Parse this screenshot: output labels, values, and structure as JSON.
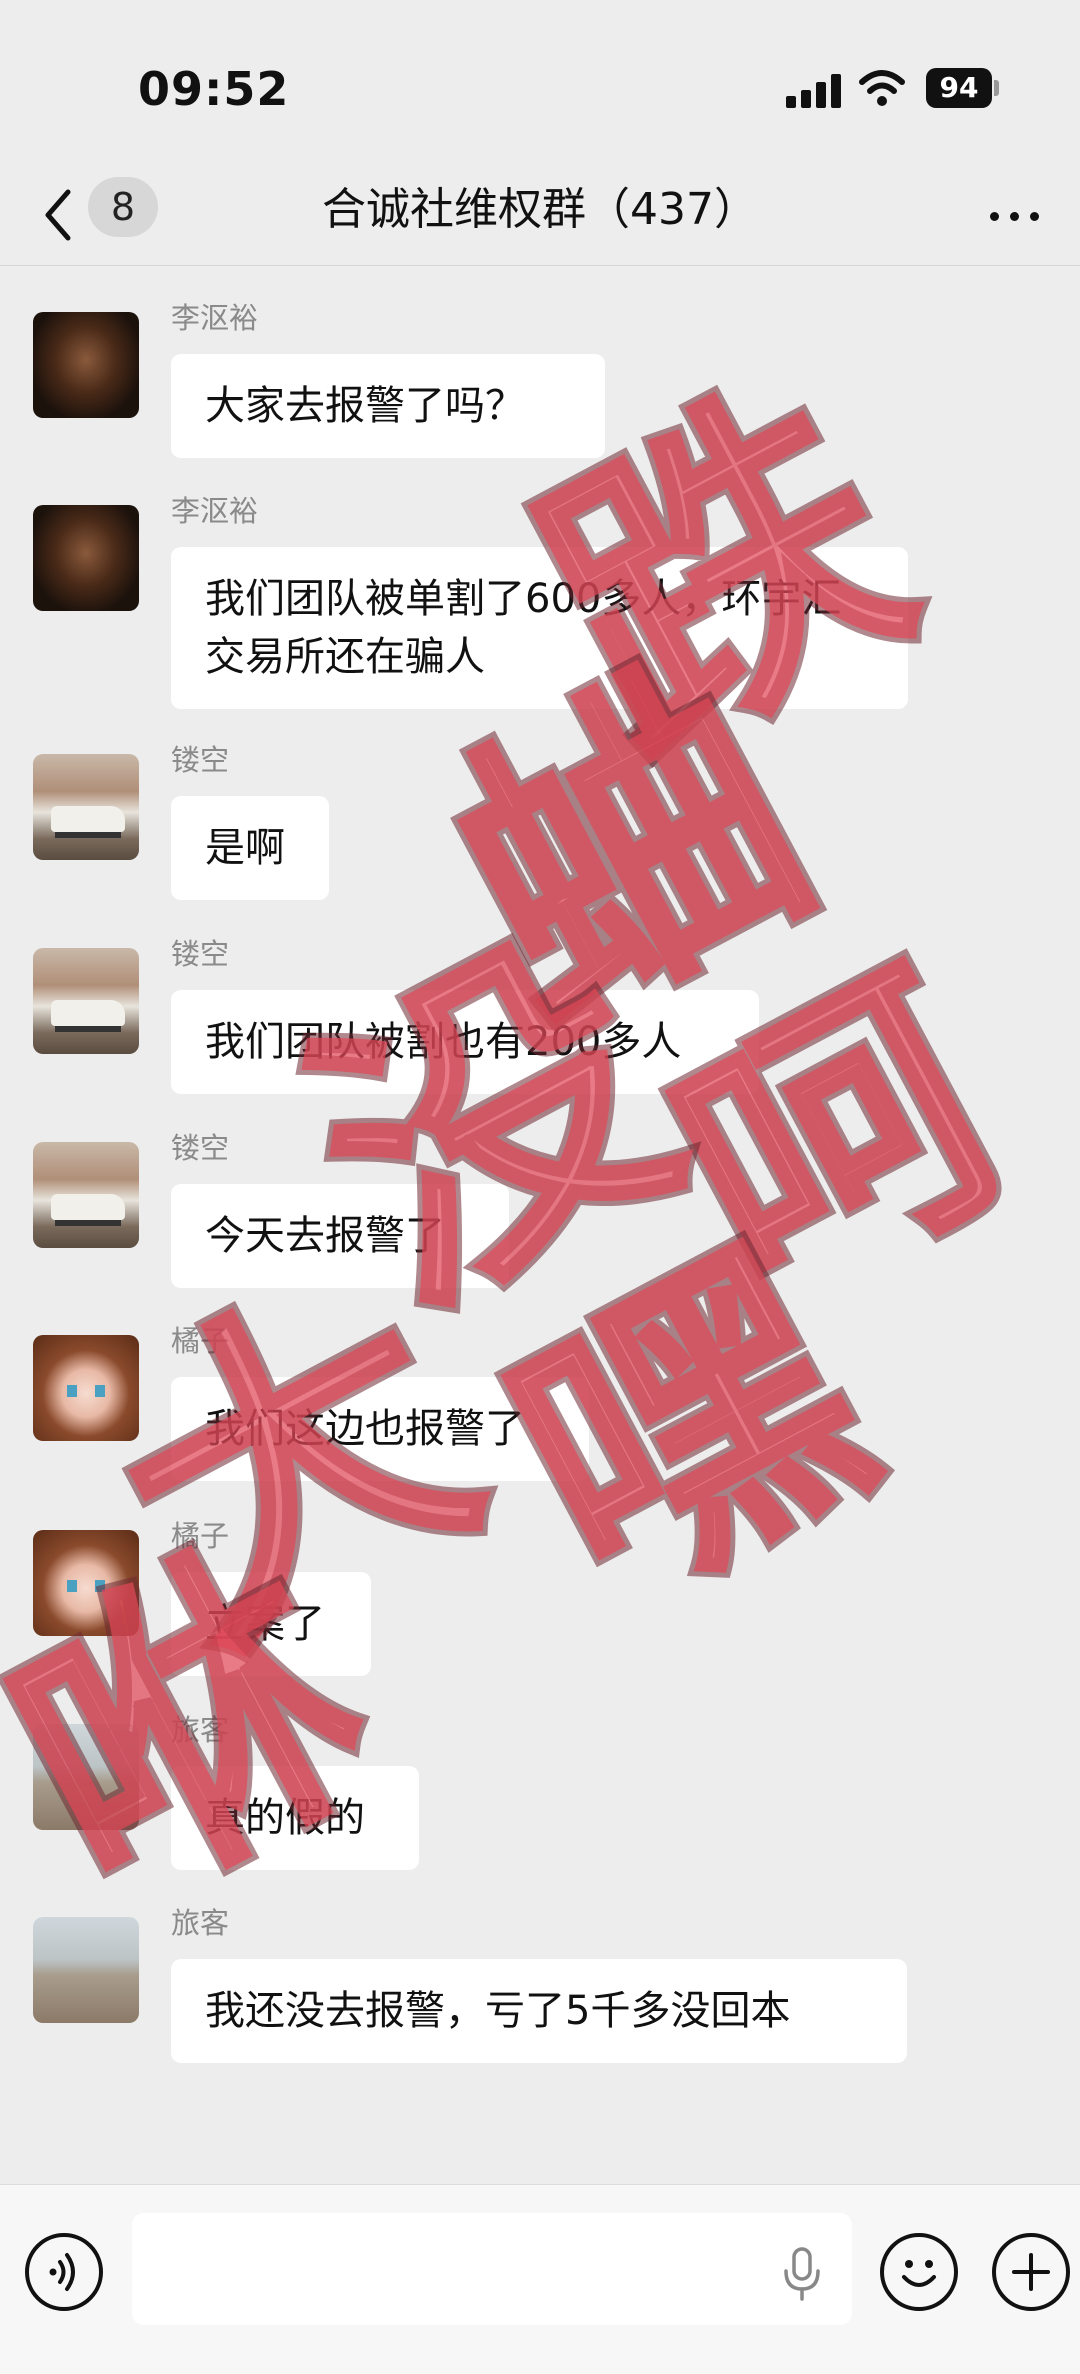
{
  "status_bar": {
    "time": "09:52",
    "battery": "94"
  },
  "nav": {
    "back_count": "8",
    "title": "合诚社维权群（437）"
  },
  "messages": [
    {
      "sender": "李沤裕",
      "text": "大家去报警了吗？",
      "avatar": "portrait-man"
    },
    {
      "sender": "李沤裕",
      "text": "我们团队被单割了600多人，环宇汇交易所还在骗人",
      "avatar": "portrait-man"
    },
    {
      "sender": "镂空",
      "text": "是啊",
      "avatar": "car-photo"
    },
    {
      "sender": "镂空",
      "text": "我们团队被割也有200多人",
      "avatar": "car-photo"
    },
    {
      "sender": "镂空",
      "text": "今天去报警了",
      "avatar": "car-photo"
    },
    {
      "sender": "橘子",
      "text": "我们这边也报警了",
      "avatar": "anime-girl"
    },
    {
      "sender": "橘子",
      "text": "立案了",
      "avatar": "anime-girl"
    },
    {
      "sender": "旅客",
      "text": "真的假的",
      "avatar": "beach-photo"
    },
    {
      "sender": "旅客",
      "text": "我还没去报警，亏了5千多没回本",
      "avatar": "beach-photo"
    }
  ],
  "watermark": {
    "chars": [
      "跌",
      "蛐",
      "呵",
      "没",
      "嘿",
      "大",
      "咻"
    ]
  },
  "colors": {
    "background": "#ededed",
    "bubble": "#ffffff",
    "watermark": "#e14858"
  },
  "icons": [
    "chevron-left-icon",
    "more-icon",
    "voice-icon",
    "microphone-icon",
    "emoji-icon",
    "plus-icon"
  ]
}
